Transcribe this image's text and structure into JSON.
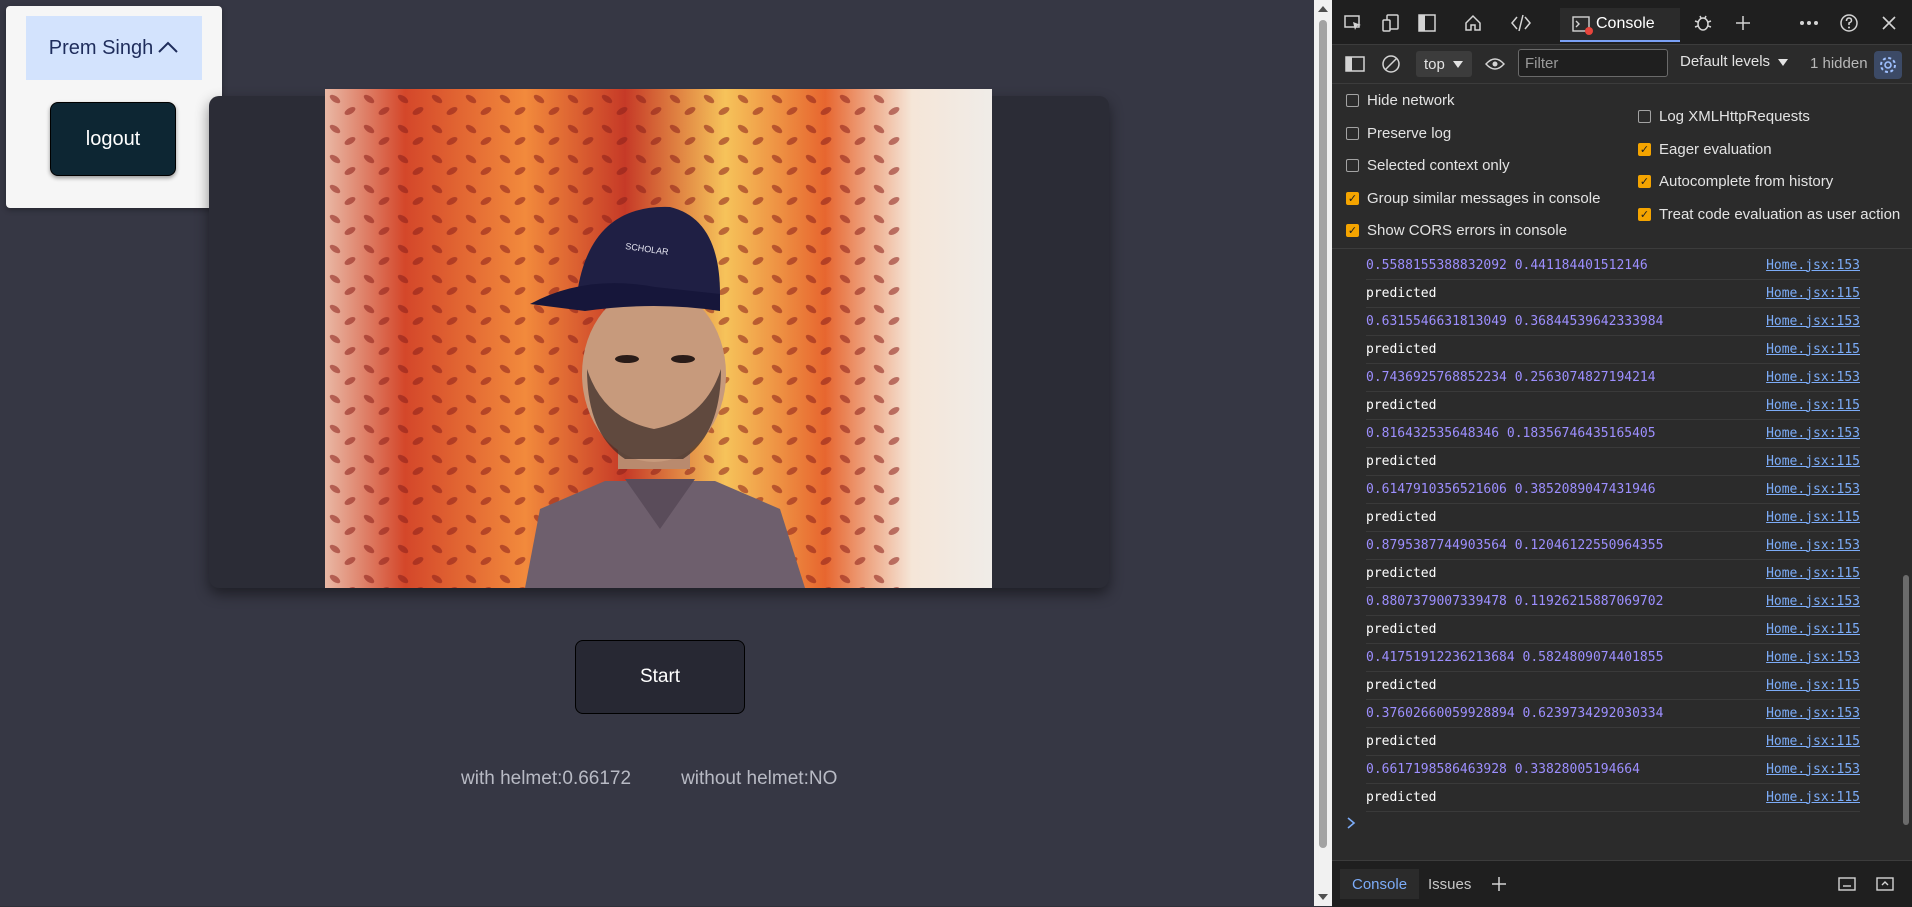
{
  "page": {
    "user_menu": {
      "name": "Prem Singh",
      "chevron": "^",
      "logout_label": "logout"
    },
    "start_label": "Start",
    "with_helmet": "with helmet:0.66172",
    "without_helmet": "without helmet:NO"
  },
  "devtools": {
    "tabs": {
      "console_label": "Console"
    },
    "toolbar": {
      "context": "top",
      "filter_placeholder": "Filter",
      "levels": "Default levels",
      "hidden": "1 hidden"
    },
    "settings": {
      "left": [
        {
          "label": "Hide network",
          "checked": false
        },
        {
          "label": "Preserve log",
          "checked": false
        },
        {
          "label": "Selected context only",
          "checked": false
        },
        {
          "label": "Group similar messages in console",
          "checked": true
        },
        {
          "label": "Show CORS errors in console",
          "checked": true
        }
      ],
      "right": [
        {
          "label": "Log XMLHttpRequests",
          "checked": false
        },
        {
          "label": "Eager evaluation",
          "checked": true
        },
        {
          "label": "Autocomplete from history",
          "checked": true
        },
        {
          "label": "Treat code evaluation as user action",
          "checked": true
        }
      ]
    },
    "logs": [
      {
        "text": "0.5588155388832092 0.441184401512146",
        "src": "Home.jsx:153",
        "kind": "num"
      },
      {
        "text": "predicted",
        "src": "Home.jsx:115",
        "kind": "str"
      },
      {
        "text": "0.6315546631813049 0.36844539642333984",
        "src": "Home.jsx:153",
        "kind": "num"
      },
      {
        "text": "predicted",
        "src": "Home.jsx:115",
        "kind": "str"
      },
      {
        "text": "0.7436925768852234 0.2563074827194214",
        "src": "Home.jsx:153",
        "kind": "num"
      },
      {
        "text": "predicted",
        "src": "Home.jsx:115",
        "kind": "str"
      },
      {
        "text": "0.816432535648346 0.18356746435165405",
        "src": "Home.jsx:153",
        "kind": "num"
      },
      {
        "text": "predicted",
        "src": "Home.jsx:115",
        "kind": "str"
      },
      {
        "text": "0.6147910356521606 0.3852089047431946",
        "src": "Home.jsx:153",
        "kind": "num"
      },
      {
        "text": "predicted",
        "src": "Home.jsx:115",
        "kind": "str"
      },
      {
        "text": "0.8795387744903564 0.12046122550964355",
        "src": "Home.jsx:153",
        "kind": "num"
      },
      {
        "text": "predicted",
        "src": "Home.jsx:115",
        "kind": "str"
      },
      {
        "text": "0.8807379007339478 0.11926215887069702",
        "src": "Home.jsx:153",
        "kind": "num"
      },
      {
        "text": "predicted",
        "src": "Home.jsx:115",
        "kind": "str"
      },
      {
        "text": "0.41751912236213684 0.5824809074401855",
        "src": "Home.jsx:153",
        "kind": "num"
      },
      {
        "text": "predicted",
        "src": "Home.jsx:115",
        "kind": "str"
      },
      {
        "text": "0.37602660059928894 0.6239734292030334",
        "src": "Home.jsx:153",
        "kind": "num"
      },
      {
        "text": "predicted",
        "src": "Home.jsx:115",
        "kind": "str"
      },
      {
        "text": "0.6617198586463928 0.33828005194664",
        "src": "Home.jsx:153",
        "kind": "num"
      },
      {
        "text": "predicted",
        "src": "Home.jsx:115",
        "kind": "str"
      }
    ],
    "drawer": {
      "console_tab": "Console",
      "issues_tab": "Issues"
    }
  }
}
